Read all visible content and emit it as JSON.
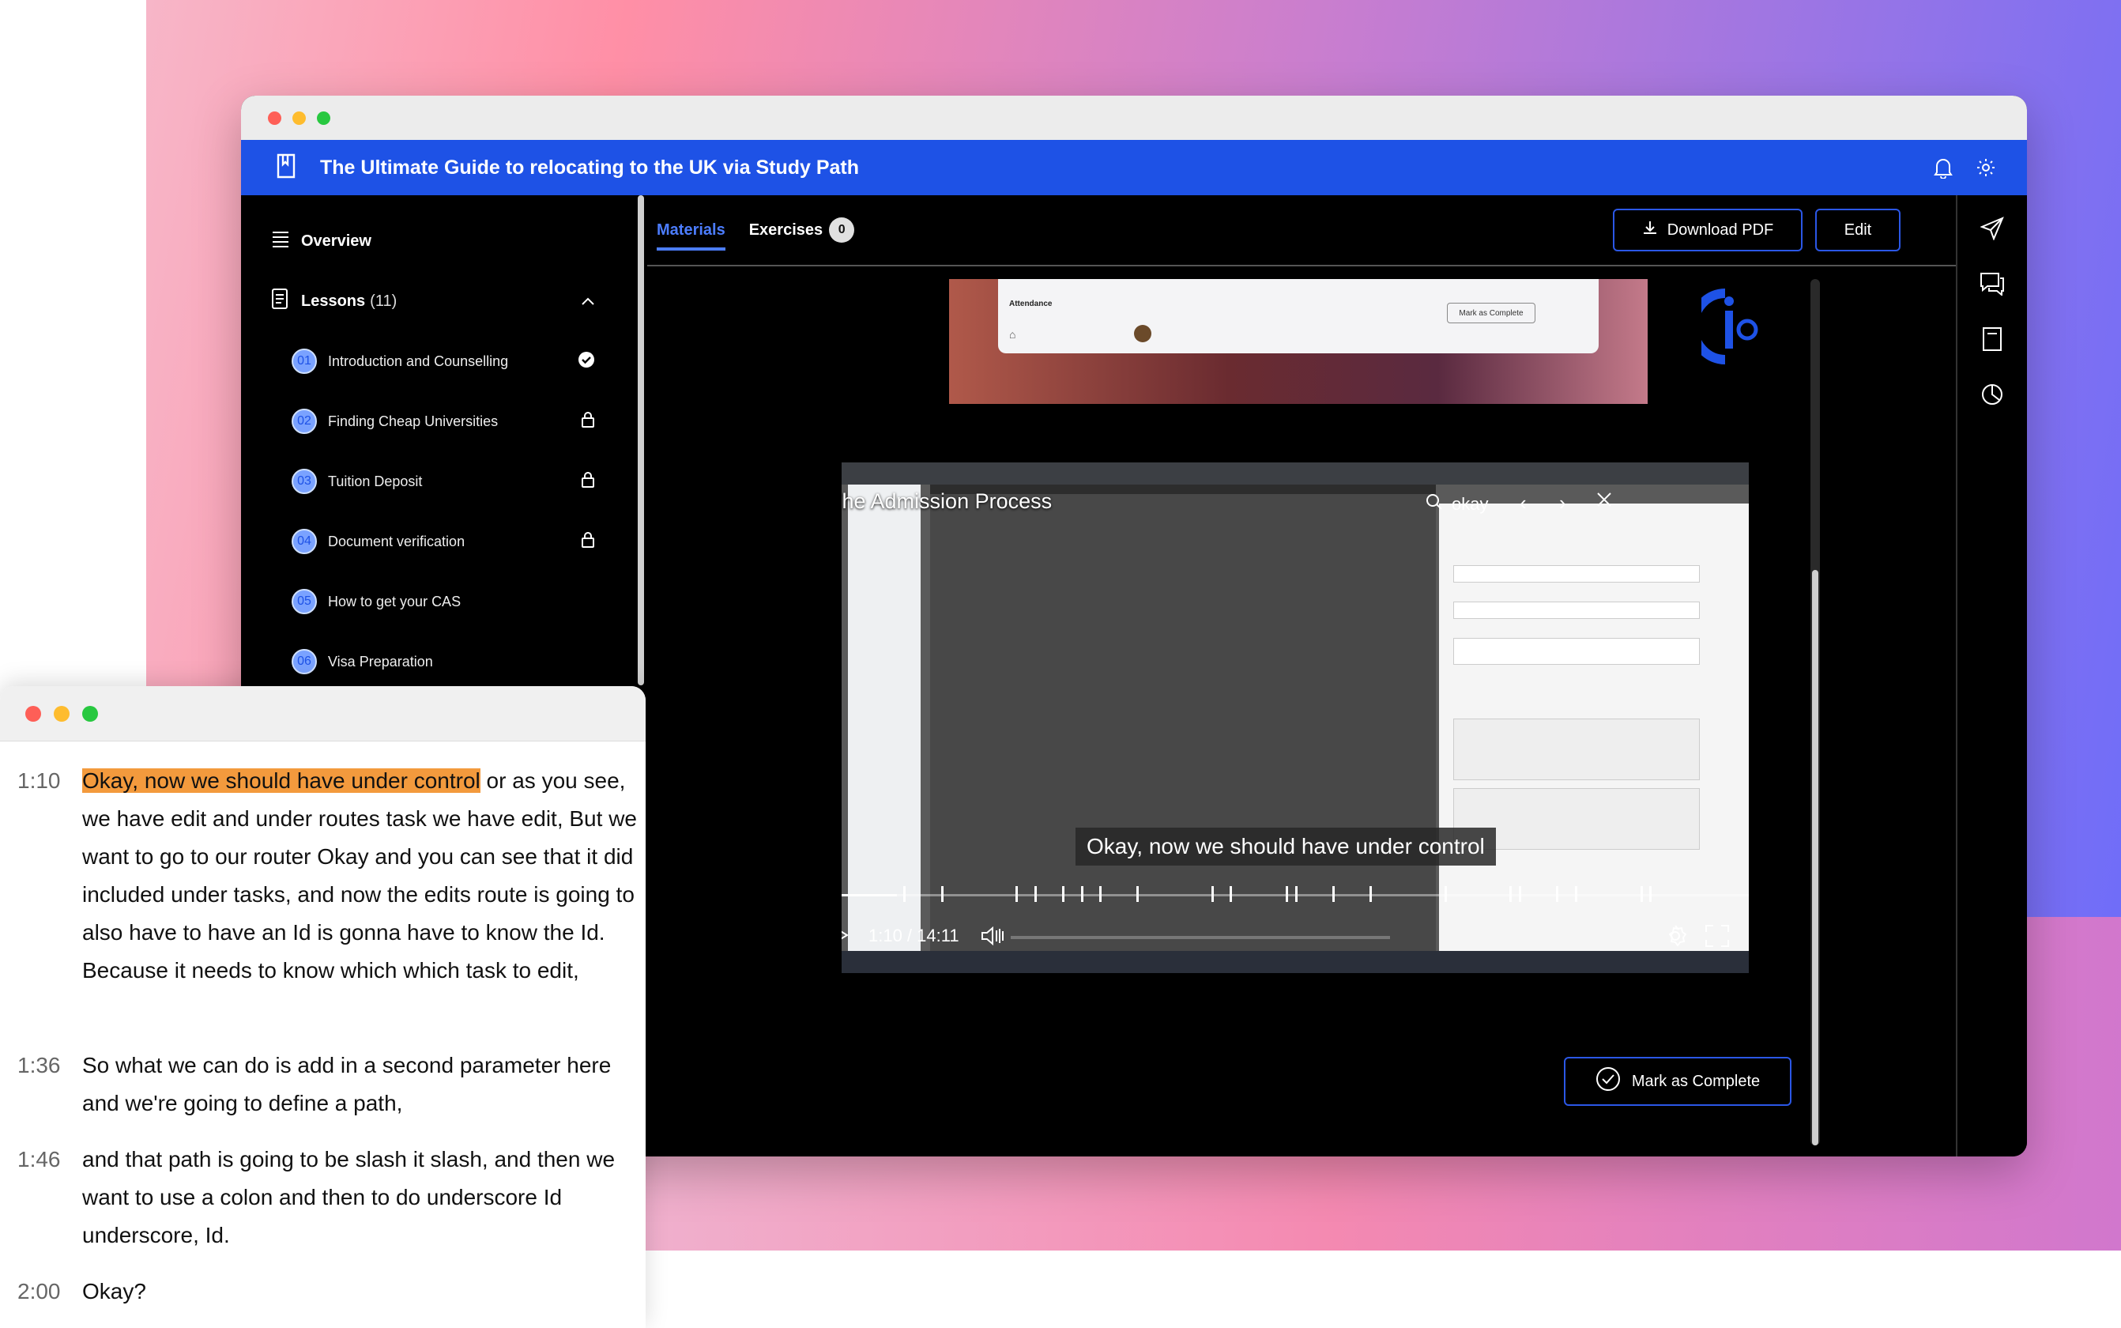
{
  "app": {
    "title": "The Ultimate Guide to relocating to the UK via Study Path"
  },
  "sidebar": {
    "overview_label": "Overview",
    "lessons_label": "Lessons",
    "lessons_count": "(11)",
    "lessons": [
      {
        "num": "01",
        "title": "Introduction and Counselling",
        "status": "completed"
      },
      {
        "num": "02",
        "title": "Finding Cheap Universities",
        "status": "locked"
      },
      {
        "num": "03",
        "title": "Tuition Deposit",
        "status": "locked"
      },
      {
        "num": "04",
        "title": "Document verification",
        "status": "locked"
      },
      {
        "num": "05",
        "title": "How to get your CAS",
        "status": "open"
      },
      {
        "num": "06",
        "title": "Visa Preparation",
        "status": "open"
      }
    ]
  },
  "tabs": {
    "materials": "Materials",
    "exercises": "Exercises",
    "exercises_count": "0"
  },
  "toolbar": {
    "download_label": "Download PDF",
    "edit_label": "Edit"
  },
  "thumbnail": {
    "attendance_label": "Attendance",
    "mark_label": "Mark as Complete"
  },
  "player": {
    "title": "The Admission Process",
    "search_value": "okay",
    "caption": "Okay, now we should have under control",
    "timecode": "1:10 / 14:11",
    "progress_fraction": 0.073
  },
  "mark_complete_label": "Mark as Complete",
  "transcript": [
    {
      "time": "1:10",
      "highlight": "Okay, now we should have under control",
      "text": " or as you see, we have edit and under routes task we have edit, But we want to go to our router Okay and you can see that it did included under tasks, and now the edits route is going to also have to have an Id is gonna have to know the Id. Because it needs to know which which task to edit,"
    },
    {
      "time": "1:36",
      "highlight": "",
      "text": "So what we can do is add in a second parameter here and we're going to define a path,"
    },
    {
      "time": "1:46",
      "highlight": "",
      "text": "and that path is going to be slash it slash, and then we want to use a colon and then to do underscore Id underscore, Id."
    },
    {
      "time": "2:00",
      "highlight": "",
      "text": "Okay?"
    }
  ],
  "colors": {
    "brand_blue": "#1e52e6",
    "highlight": "#f39a3d"
  },
  "icons": [
    "book-icon",
    "bell-icon",
    "sun-icon",
    "list-icon",
    "lessons-icon",
    "chevron-up-icon",
    "check-circle-icon",
    "lock-icon",
    "download-icon",
    "send-icon",
    "chat-icon",
    "notes-icon",
    "pie-chart-icon",
    "search-icon",
    "close-icon",
    "play-icon",
    "volume-icon",
    "settings-icon",
    "fullscreen-icon"
  ]
}
